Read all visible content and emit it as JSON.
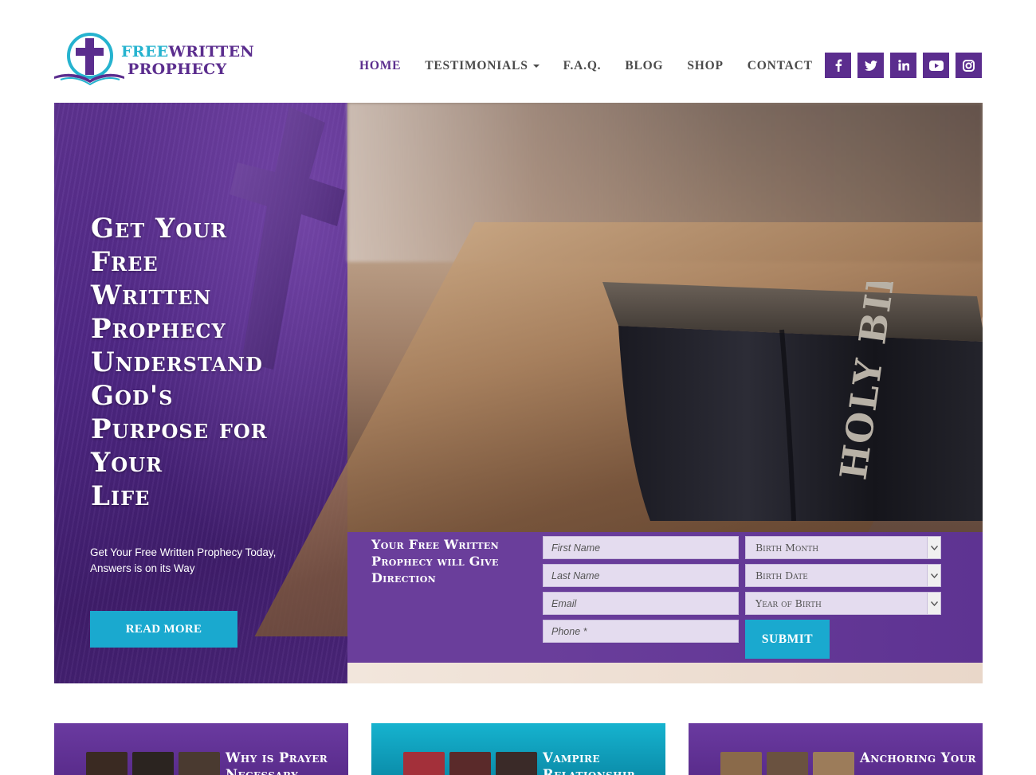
{
  "header": {
    "logo": {
      "line1_a": "FREE",
      "line1_b": "WRITTEN",
      "line2": "PROPHECY"
    },
    "nav": [
      {
        "label": "HOME",
        "active": true
      },
      {
        "label": "TESTIMONIALS",
        "dropdown": true
      },
      {
        "label": "F.A.Q."
      },
      {
        "label": "BLOG"
      },
      {
        "label": "SHOP"
      },
      {
        "label": "CONTACT"
      }
    ],
    "social": [
      "facebook-icon",
      "twitter-icon",
      "linkedin-icon",
      "youtube-icon",
      "instagram-icon"
    ]
  },
  "hero": {
    "title_lines": [
      "Get Your",
      "Free",
      "Written",
      "Prophecy",
      "Understand",
      "God's",
      "Purpose for",
      "Your",
      "Life"
    ],
    "subtitle": "Get Your Free Written Prophecy Today, Answers is on its Way",
    "read_more": "READ MORE",
    "book_spine_text": "HOLY BIBLE"
  },
  "form": {
    "heading": "Your Free Written Prophecy will Give Direction",
    "first_name_placeholder": "First Name",
    "last_name_placeholder": "Last Name",
    "email_placeholder": "Email",
    "phone_placeholder": "Phone *",
    "birth_month": "Birth Month",
    "birth_date": "Birth Date",
    "year_of_birth": "Year of Birth",
    "submit": "SUBMIT"
  },
  "cards": [
    {
      "title": "Why is Prayer Necessary"
    },
    {
      "title": "Vampire Relationship"
    },
    {
      "title": "Anchoring Your"
    }
  ],
  "colors": {
    "brand_purple": "#5b2d8e",
    "brand_cyan": "#1aa9cf"
  }
}
